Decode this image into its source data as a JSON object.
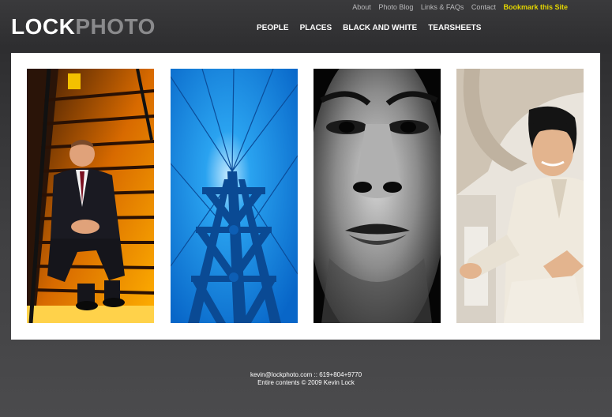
{
  "header": {
    "logo_part1": "LOCK",
    "logo_part2": "PHOTO"
  },
  "utility_nav": [
    "About",
    "Photo Blog",
    "Links & FAQs",
    "Contact"
  ],
  "bookmark_label": "Bookmark this Site",
  "main_nav": [
    "PEOPLE",
    "PLACES",
    "BLACK AND WHITE",
    "TEARSHEETS"
  ],
  "photos": [
    {
      "subject": "businessman on lit staircase"
    },
    {
      "subject": "blue bridge tower"
    },
    {
      "subject": "black and white face close-up"
    },
    {
      "subject": "smiling man in white suit"
    }
  ],
  "footer": {
    "contact": "kevin@lockphoto.com :: 619+804+9770",
    "copyright": "Entire contents © 2009 Kevin Lock"
  }
}
